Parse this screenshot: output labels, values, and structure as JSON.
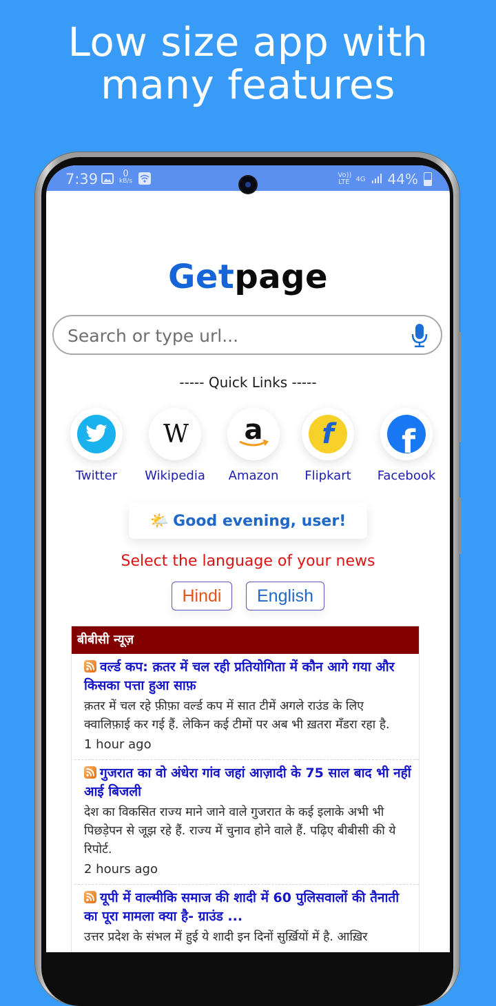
{
  "promo": {
    "line1": "Low size app with",
    "line2": "many features"
  },
  "status_bar": {
    "time": "7:39",
    "net_speed_value": "0",
    "net_speed_unit": "kB/s",
    "volte": "Vo)) LTE",
    "network": "4G",
    "battery": "44%",
    "icons": [
      "image-icon",
      "wifi-icon",
      "signal-icon",
      "battery-icon"
    ]
  },
  "logo": {
    "part1": "Get",
    "part2": "page"
  },
  "search": {
    "placeholder": "Search or type url...",
    "value": "",
    "mic_icon": "microphone-icon"
  },
  "quick_links": {
    "title": "----- Quick Links -----",
    "items": [
      {
        "label": "Twitter",
        "icon": "twitter-icon"
      },
      {
        "label": "Wikipedia",
        "icon": "wikipedia-icon"
      },
      {
        "label": "Amazon",
        "icon": "amazon-icon"
      },
      {
        "label": "Flipkart",
        "icon": "flipkart-icon"
      },
      {
        "label": "Facebook",
        "icon": "facebook-icon"
      }
    ]
  },
  "greeting": {
    "emoji": "🌤️",
    "text": "Good evening, user!"
  },
  "language": {
    "title": "Select the language of your news",
    "options": [
      "Hindi",
      "English"
    ]
  },
  "news": {
    "header": "बीबीसी न्यूज़",
    "items": [
      {
        "title": "वर्ल्ड कप: क़तर में चल रही प्रतियोगिता में कौन आगे गया और किसका पत्ता हुआ साफ़",
        "description": "क़तर में चल रहे फ़ीफ़ा वर्ल्ड कप में सात टीमें अगले राउंड के लिए क्वालिफ़ाई कर गई हैं. लेकिन कई टीमों पर अब भी ख़तरा मँडरा रहा है.",
        "time": "1 hour ago"
      },
      {
        "title": "गुजरात का वो अंधेरा गांव जहां आज़ादी के 75 साल बाद भी नहीं आई बिजली",
        "description": "देश का विकसित राज्य माने जाने वाले गुजरात के कई इलाके अभी भी पिछड़ेपन से जूझ रहे हैं. राज्य में चुनाव होने वाले हैं. पढ़िए बीबीसी की ये रिपोर्ट.",
        "time": "2 hours ago"
      },
      {
        "title": "यूपी में वाल्मीकि समाज की शादी में 60 पुलिसवालों की तैनाती का पूरा मामला क्या है- ग्राउंड ...",
        "description": "उत्तर प्रदेश के संभल में हुई ये शादी इन दिनों सुर्ख़ियों में है. आख़िर",
        "time": ""
      }
    ]
  },
  "colors": {
    "background": "#379bf7",
    "status_bar": "#5b8ff0",
    "logo_accent": "#1565d8",
    "link": "#1d1db0",
    "news_header": "#820000",
    "language_title": "#dd1313",
    "hindi_button": "#e0561a",
    "english_button": "#1f68c8"
  }
}
